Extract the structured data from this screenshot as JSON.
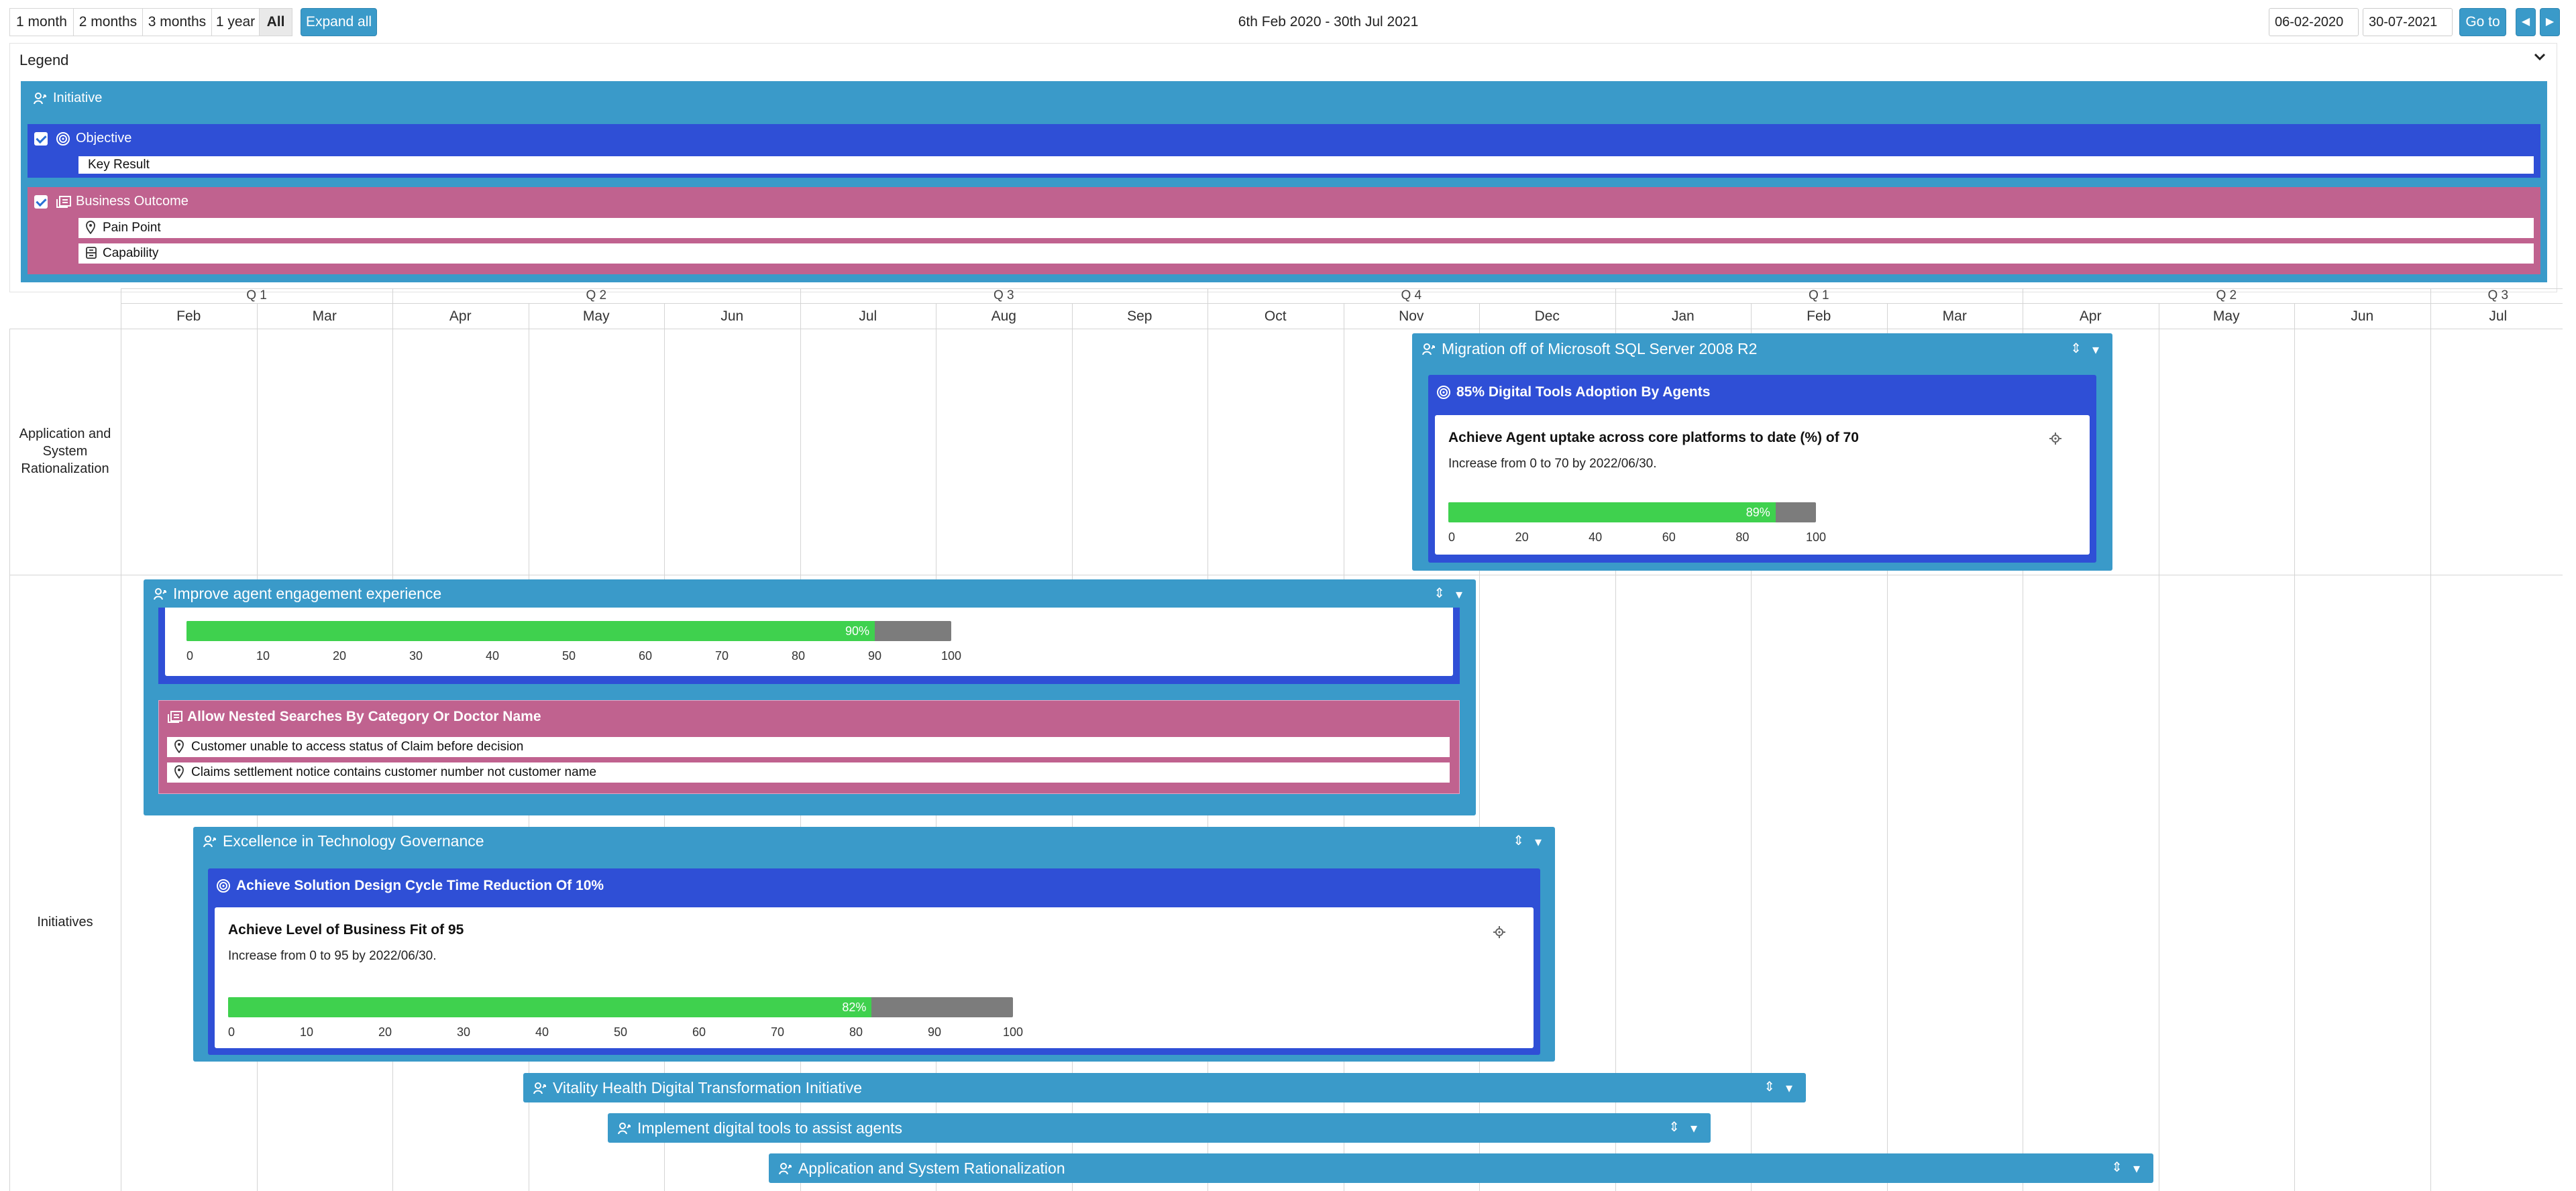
{
  "toolbar": {
    "ranges": [
      "1 month",
      "2 months",
      "3 months",
      "1 year",
      "All"
    ],
    "active_range": "All",
    "expand_all": "Expand all",
    "date_range_text": "6th Feb 2020 - 30th Jul 2021",
    "start_date": "06-02-2020",
    "end_date": "30-07-2021",
    "go_to": "Go to",
    "prev": "◀",
    "next": "▶"
  },
  "legend": {
    "title": "Legend",
    "initiative": "Initiative",
    "objective": "Objective",
    "key_result": "Key Result",
    "business_outcome": "Business Outcome",
    "pain_point": "Pain Point",
    "capability": "Capability",
    "objective_checked": true,
    "business_outcome_checked": true
  },
  "timeline": {
    "quarters": [
      "Q 1",
      "Q 2",
      "Q 3",
      "Q 4",
      "Q 1",
      "Q 2",
      "Q 3"
    ],
    "months": [
      "Feb",
      "Mar",
      "Apr",
      "May",
      "Jun",
      "Jul",
      "Aug",
      "Sep",
      "Oct",
      "Nov",
      "Dec",
      "Jan",
      "Feb",
      "Mar",
      "Apr",
      "May",
      "Jun",
      "Jul"
    ]
  },
  "rows": [
    {
      "label": "Application and System Rationalization"
    },
    {
      "label": "Initiatives"
    }
  ],
  "cards": {
    "migration": {
      "title": "Migration off of Microsoft SQL Server 2008 R2",
      "objective": "85% Digital Tools Adoption By Agents",
      "kr_title": "Achieve Agent uptake across core platforms to date (%) of 70",
      "kr_sub": "Increase from 0 to 70 by 2022/06/30.",
      "progress": 89,
      "progress_label": "89%",
      "ticks": [
        "0",
        "20",
        "40",
        "60",
        "80",
        "100"
      ]
    },
    "improve": {
      "title": "Improve agent engagement experience",
      "progress": 90,
      "progress_label": "90%",
      "ticks": [
        "0",
        "10",
        "20",
        "30",
        "40",
        "50",
        "60",
        "70",
        "80",
        "90",
        "100"
      ],
      "business_outcome": "Allow Nested Searches By Category Or Doctor Name",
      "pain_points": [
        "Customer unable to access status of Claim before decision",
        "Claims settlement notice contains customer number not customer name"
      ]
    },
    "excellence": {
      "title": "Excellence in Technology Governance",
      "objective": "Achieve Solution Design Cycle Time Reduction Of 10%",
      "kr_title": "Achieve Level of Business Fit of 95",
      "kr_sub": "Increase from 0 to 95 by 2022/06/30.",
      "progress": 82,
      "progress_label": "82%",
      "ticks": [
        "0",
        "10",
        "20",
        "30",
        "40",
        "50",
        "60",
        "70",
        "80",
        "90",
        "100"
      ]
    },
    "vitality": {
      "title": "Vitality Health Digital Transformation Initiative"
    },
    "digital": {
      "title": "Implement digital tools to assist agents"
    },
    "appsys": {
      "title": "Application and System Rationalization"
    }
  },
  "colors": {
    "initiative": "#3a9ac9",
    "objective": "#2f4fd6",
    "business_outcome": "#c0628f",
    "progress_fill": "#3fd14e",
    "progress_track": "#7c7c7c"
  }
}
